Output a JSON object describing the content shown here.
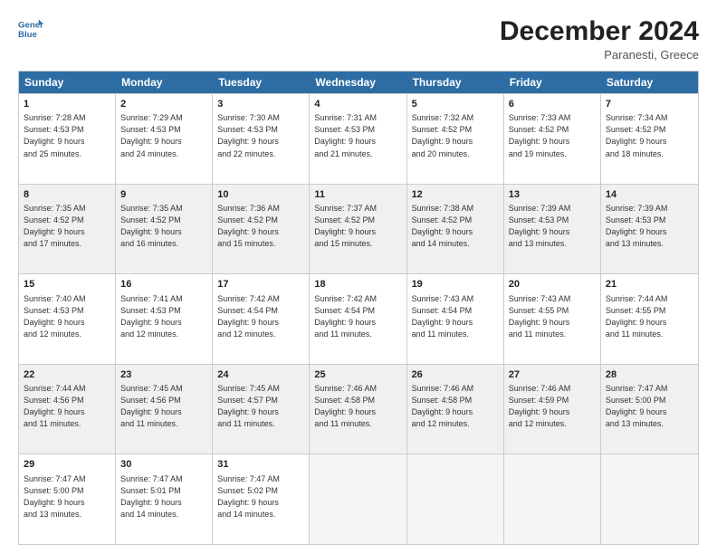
{
  "header": {
    "logo_line1": "General",
    "logo_line2": "Blue",
    "title": "December 2024",
    "subtitle": "Paranesti, Greece"
  },
  "days_of_week": [
    "Sunday",
    "Monday",
    "Tuesday",
    "Wednesday",
    "Thursday",
    "Friday",
    "Saturday"
  ],
  "rows": [
    [
      {
        "num": "1",
        "lines": [
          "Sunrise: 7:28 AM",
          "Sunset: 4:53 PM",
          "Daylight: 9 hours",
          "and 25 minutes."
        ]
      },
      {
        "num": "2",
        "lines": [
          "Sunrise: 7:29 AM",
          "Sunset: 4:53 PM",
          "Daylight: 9 hours",
          "and 24 minutes."
        ]
      },
      {
        "num": "3",
        "lines": [
          "Sunrise: 7:30 AM",
          "Sunset: 4:53 PM",
          "Daylight: 9 hours",
          "and 22 minutes."
        ]
      },
      {
        "num": "4",
        "lines": [
          "Sunrise: 7:31 AM",
          "Sunset: 4:53 PM",
          "Daylight: 9 hours",
          "and 21 minutes."
        ]
      },
      {
        "num": "5",
        "lines": [
          "Sunrise: 7:32 AM",
          "Sunset: 4:52 PM",
          "Daylight: 9 hours",
          "and 20 minutes."
        ]
      },
      {
        "num": "6",
        "lines": [
          "Sunrise: 7:33 AM",
          "Sunset: 4:52 PM",
          "Daylight: 9 hours",
          "and 19 minutes."
        ]
      },
      {
        "num": "7",
        "lines": [
          "Sunrise: 7:34 AM",
          "Sunset: 4:52 PM",
          "Daylight: 9 hours",
          "and 18 minutes."
        ]
      }
    ],
    [
      {
        "num": "8",
        "lines": [
          "Sunrise: 7:35 AM",
          "Sunset: 4:52 PM",
          "Daylight: 9 hours",
          "and 17 minutes."
        ]
      },
      {
        "num": "9",
        "lines": [
          "Sunrise: 7:35 AM",
          "Sunset: 4:52 PM",
          "Daylight: 9 hours",
          "and 16 minutes."
        ]
      },
      {
        "num": "10",
        "lines": [
          "Sunrise: 7:36 AM",
          "Sunset: 4:52 PM",
          "Daylight: 9 hours",
          "and 15 minutes."
        ]
      },
      {
        "num": "11",
        "lines": [
          "Sunrise: 7:37 AM",
          "Sunset: 4:52 PM",
          "Daylight: 9 hours",
          "and 15 minutes."
        ]
      },
      {
        "num": "12",
        "lines": [
          "Sunrise: 7:38 AM",
          "Sunset: 4:52 PM",
          "Daylight: 9 hours",
          "and 14 minutes."
        ]
      },
      {
        "num": "13",
        "lines": [
          "Sunrise: 7:39 AM",
          "Sunset: 4:53 PM",
          "Daylight: 9 hours",
          "and 13 minutes."
        ]
      },
      {
        "num": "14",
        "lines": [
          "Sunrise: 7:39 AM",
          "Sunset: 4:53 PM",
          "Daylight: 9 hours",
          "and 13 minutes."
        ]
      }
    ],
    [
      {
        "num": "15",
        "lines": [
          "Sunrise: 7:40 AM",
          "Sunset: 4:53 PM",
          "Daylight: 9 hours",
          "and 12 minutes."
        ]
      },
      {
        "num": "16",
        "lines": [
          "Sunrise: 7:41 AM",
          "Sunset: 4:53 PM",
          "Daylight: 9 hours",
          "and 12 minutes."
        ]
      },
      {
        "num": "17",
        "lines": [
          "Sunrise: 7:42 AM",
          "Sunset: 4:54 PM",
          "Daylight: 9 hours",
          "and 12 minutes."
        ]
      },
      {
        "num": "18",
        "lines": [
          "Sunrise: 7:42 AM",
          "Sunset: 4:54 PM",
          "Daylight: 9 hours",
          "and 11 minutes."
        ]
      },
      {
        "num": "19",
        "lines": [
          "Sunrise: 7:43 AM",
          "Sunset: 4:54 PM",
          "Daylight: 9 hours",
          "and 11 minutes."
        ]
      },
      {
        "num": "20",
        "lines": [
          "Sunrise: 7:43 AM",
          "Sunset: 4:55 PM",
          "Daylight: 9 hours",
          "and 11 minutes."
        ]
      },
      {
        "num": "21",
        "lines": [
          "Sunrise: 7:44 AM",
          "Sunset: 4:55 PM",
          "Daylight: 9 hours",
          "and 11 minutes."
        ]
      }
    ],
    [
      {
        "num": "22",
        "lines": [
          "Sunrise: 7:44 AM",
          "Sunset: 4:56 PM",
          "Daylight: 9 hours",
          "and 11 minutes."
        ]
      },
      {
        "num": "23",
        "lines": [
          "Sunrise: 7:45 AM",
          "Sunset: 4:56 PM",
          "Daylight: 9 hours",
          "and 11 minutes."
        ]
      },
      {
        "num": "24",
        "lines": [
          "Sunrise: 7:45 AM",
          "Sunset: 4:57 PM",
          "Daylight: 9 hours",
          "and 11 minutes."
        ]
      },
      {
        "num": "25",
        "lines": [
          "Sunrise: 7:46 AM",
          "Sunset: 4:58 PM",
          "Daylight: 9 hours",
          "and 11 minutes."
        ]
      },
      {
        "num": "26",
        "lines": [
          "Sunrise: 7:46 AM",
          "Sunset: 4:58 PM",
          "Daylight: 9 hours",
          "and 12 minutes."
        ]
      },
      {
        "num": "27",
        "lines": [
          "Sunrise: 7:46 AM",
          "Sunset: 4:59 PM",
          "Daylight: 9 hours",
          "and 12 minutes."
        ]
      },
      {
        "num": "28",
        "lines": [
          "Sunrise: 7:47 AM",
          "Sunset: 5:00 PM",
          "Daylight: 9 hours",
          "and 13 minutes."
        ]
      }
    ],
    [
      {
        "num": "29",
        "lines": [
          "Sunrise: 7:47 AM",
          "Sunset: 5:00 PM",
          "Daylight: 9 hours",
          "and 13 minutes."
        ]
      },
      {
        "num": "30",
        "lines": [
          "Sunrise: 7:47 AM",
          "Sunset: 5:01 PM",
          "Daylight: 9 hours",
          "and 14 minutes."
        ]
      },
      {
        "num": "31",
        "lines": [
          "Sunrise: 7:47 AM",
          "Sunset: 5:02 PM",
          "Daylight: 9 hours",
          "and 14 minutes."
        ]
      },
      null,
      null,
      null,
      null
    ]
  ]
}
